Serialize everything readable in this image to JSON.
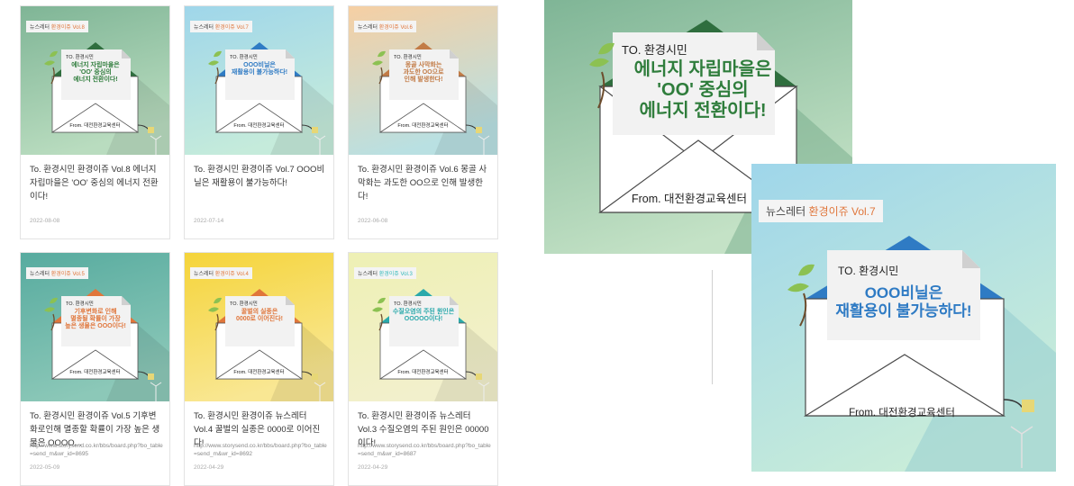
{
  "cards": [
    {
      "tag_prefix": "뉴스레터 ",
      "tag_vol": "환경이쥬 Vol.8",
      "to": "TO. 환경시민",
      "letter_lines": [
        "에너지 자립마을은",
        "'OO' 중심의",
        "에너지 전환이다!"
      ],
      "from": "From. 대전환경교육센터",
      "title": "To. 환경시민 환경이쥬 Vol.8 에너지자립마을은 'OO' 중심의 에너지 전환이다!",
      "url": "",
      "date": "2022-08-08"
    },
    {
      "tag_prefix": "뉴스레터 ",
      "tag_vol": "환경이쥬 Vol.7",
      "to": "TO. 환경시민",
      "letter_lines": [
        "OOO비닐은",
        "재활용이 불가능하다!"
      ],
      "from": "From. 대전환경교육센터",
      "title": "To. 환경시민 환경이쥬 Vol.7 OOO비닐은 재활용이 불가능하다!",
      "url": "",
      "date": "2022-07-14"
    },
    {
      "tag_prefix": "뉴스레터 ",
      "tag_vol": "환경이쥬 Vol.6",
      "to": "TO. 환경시민",
      "letter_lines": [
        "몽골 사막화는",
        "과도한 OO으로",
        "인해 발생한다!"
      ],
      "from": "From. 대전환경교육센터",
      "title": "To. 환경시민 환경이쥬 Vol.6 몽골 사막화는 과도한 OO으로 인해 발생한다!",
      "url": "",
      "date": "2022-06-08"
    },
    {
      "tag_prefix": "뉴스레터 ",
      "tag_vol": "환경이쥬 Vol.5",
      "to": "TO. 환경시민",
      "letter_lines": [
        "기후변화로 인해",
        "멸종될 확률이 가장",
        "높은 생물은 OOO이다!"
      ],
      "from": "From. 대전환경교육센터",
      "title": "To. 환경시민 환경이쥬 Vol.5 기후변화로인해 멸종할 확률이 가장 높은 생물은 OOOO...",
      "url": "http://www.storysend.co.kr/bbs/board.php?bo_table=send_m&wr_id=8695",
      "date": "2022-05-09"
    },
    {
      "tag_prefix": "뉴스레터 ",
      "tag_vol": "환경이쥬 Vol.4",
      "to": "TO. 환경시민",
      "letter_lines": [
        "꿀벌의 실종은",
        "0000로 이어진다!"
      ],
      "from": "From. 대전환경교육센터",
      "title": "To. 환경시민 환경이쥬 뉴스레터 Vol.4 꿀벌의 실종은 0000로 이어진다!",
      "url": "http://www.storysend.co.kr/bbs/board.php?bo_table=send_m&wr_id=8692",
      "date": "2022-04-29"
    },
    {
      "tag_prefix": "뉴스레터 ",
      "tag_vol": "환경이쥬 Vol.3",
      "to": "TO. 환경시민",
      "letter_lines": [
        "수질오염의 주된 원인은",
        "OOOOO이다!"
      ],
      "from": "From. 대전환경교육센터",
      "title": "To. 환경시민 환경이쥬 뉴스레터 Vol.3 수질오염의 주된 원인은 00000이다!",
      "url": "http://www.storysend.co.kr/bbs/board.php?bo_table=send_m&wr_id=8687",
      "date": "2022-04-29"
    }
  ],
  "large_vol8": {
    "to": "TO. 환경시민",
    "letter_lines": [
      "에너지 자립마을은",
      "'OO' 중심의",
      "에너지 전환이다!"
    ],
    "from": "From. 대전환경교육센터"
  },
  "large_vol7": {
    "tag_prefix": "뉴스레터 ",
    "tag_vol": "환경이쥬 Vol.7",
    "to": "TO. 환경시민",
    "letter_lines": [
      "OOO비닐은",
      "재활용이 불가능하다!"
    ],
    "from": "From. 대전환경교육센터"
  },
  "colors": {
    "vol8_bg": "#8fc29d",
    "vol7_bg": "#a9dbe6",
    "vol6_bg": "#f6d2a8",
    "vol5_bg": "#5fb1a6",
    "vol4_bg": "#f5d83a",
    "vol3_bg": "#eef0b4",
    "orange": "#e0763b",
    "blue": "#2f7bc4",
    "green_text": "#2f7d3c",
    "cyan": "#34b9bb"
  }
}
